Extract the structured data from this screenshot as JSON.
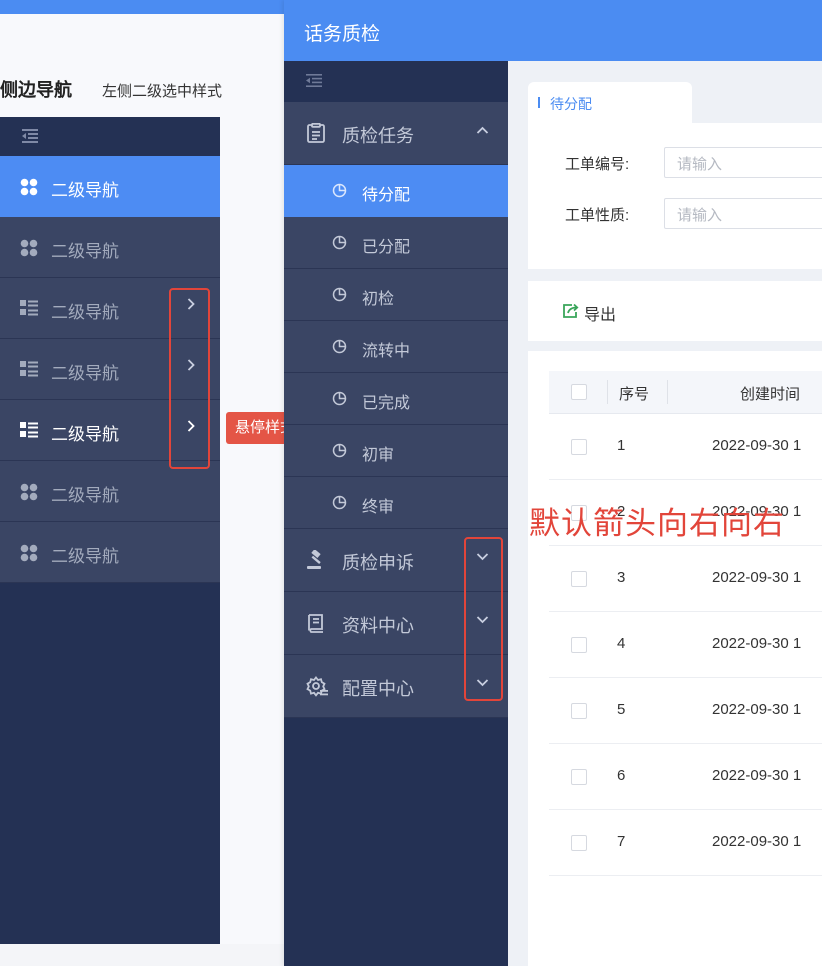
{
  "spec": {
    "title": "侧边导航",
    "subtitle": "左侧二级选中样式",
    "nav_items": [
      {
        "label": "二级导航",
        "icon": "grid-icon",
        "state": "active",
        "arrow": false
      },
      {
        "label": "二级导航",
        "icon": "grid-icon",
        "state": "normal",
        "arrow": false
      },
      {
        "label": "二级导航",
        "icon": "list-icon",
        "state": "normal",
        "arrow": true
      },
      {
        "label": "二级导航",
        "icon": "list-icon",
        "state": "normal",
        "arrow": true
      },
      {
        "label": "二级导航",
        "icon": "list-icon",
        "state": "hover",
        "arrow": true
      },
      {
        "label": "二级导航",
        "icon": "grid-icon",
        "state": "normal",
        "arrow": false
      },
      {
        "label": "二级导航",
        "icon": "grid-icon",
        "state": "normal",
        "arrow": false
      }
    ],
    "hover_tip": "悬停样式"
  },
  "app": {
    "title": "话务质检",
    "sidebar": {
      "groups": [
        {
          "label": "质检任务",
          "icon": "clipboard-icon",
          "expanded": true
        },
        {
          "label": "质检申诉",
          "icon": "gavel-icon",
          "expanded": false
        },
        {
          "label": "资料中心",
          "icon": "book-icon",
          "expanded": false
        },
        {
          "label": "配置中心",
          "icon": "settings-icon",
          "expanded": false
        }
      ],
      "sub_items": [
        {
          "label": "待分配",
          "active": true
        },
        {
          "label": "已分配",
          "active": false
        },
        {
          "label": "初检",
          "active": false
        },
        {
          "label": "流转中",
          "active": false
        },
        {
          "label": "已完成",
          "active": false
        },
        {
          "label": "初审",
          "active": false
        },
        {
          "label": "终审",
          "active": false
        }
      ]
    },
    "tab": {
      "label": "待分配"
    },
    "filters": [
      {
        "label": "工单编号:",
        "placeholder": "请输入"
      },
      {
        "label": "工单性质:",
        "placeholder": "请输入"
      }
    ],
    "toolbar": {
      "export_label": "导出"
    },
    "table": {
      "headers": [
        "序号",
        "创建时间"
      ],
      "rows": [
        {
          "no": "1",
          "time": "2022-09-30 1"
        },
        {
          "no": "2",
          "time": "2022-09-30 1"
        },
        {
          "no": "3",
          "time": "2022-09-30 1"
        },
        {
          "no": "4",
          "time": "2022-09-30 1"
        },
        {
          "no": "5",
          "time": "2022-09-30 1"
        },
        {
          "no": "6",
          "time": "2022-09-30 1"
        },
        {
          "no": "7",
          "time": "2022-09-30 1"
        }
      ]
    }
  },
  "annotation": "默认箭头向右向右",
  "colors": {
    "accent": "#4b8cf2",
    "sidebar_bg": "#243154",
    "item_bg": "#3a4564",
    "annotation_red": "#e2453a"
  }
}
